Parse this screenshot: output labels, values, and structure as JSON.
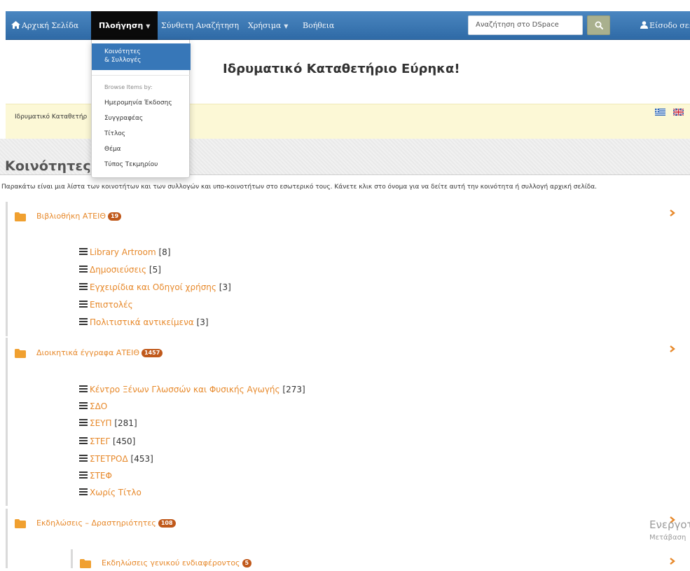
{
  "navbar": {
    "home_label": "Αρχική Σελίδα",
    "browse_label": "Πλοήγηση",
    "advanced_search_label": "Σύνθετη Αναζήτηση",
    "tools_label": "Χρήσιμα",
    "help_label": "Βοήθεια",
    "search_placeholder": "Αναζήτηση στο DSpace",
    "login_label": "Είσοδο σε:",
    "bar_color": "#3c78b4",
    "active_color": "#0a0a0a"
  },
  "dropdown": {
    "active_item_line1": "Κοινότητες",
    "active_item_line2": "& Συλλογές",
    "section_header": "Browse Items by:",
    "items": [
      "Ημερομηνία Έκδοσης",
      "Συγγραφέας",
      "Τίτλος",
      "Θέμα",
      "Τύπος Τεκμηρίου"
    ]
  },
  "header": {
    "title": "Ιδρυματικό Καταθετήριο Εύρηκα!"
  },
  "trail": {
    "text": "Ιδρυματικό Καταθετήρ",
    "flags": [
      "greek-flag-icon",
      "uk-flag-icon"
    ]
  },
  "main": {
    "heading": "Κοινότητες κ",
    "intro": "Παρακάτω είναι μια λίστα των κοινοτήτων και των συλλογών και υπο-κοινοτήτων στο εσωτερικό τους. Κάνετε κλικ στο όνομα για να δείτε αυτή την κοινότητα ή συλλογή αρχική σελίδα.",
    "communities": [
      {
        "name": "Βιβλιοθήκη ΑΤΕΙΘ",
        "count": "19",
        "collections": [
          {
            "name": "Library Artroom",
            "count": "[8]"
          },
          {
            "name": "Δημοσιεύσεις",
            "count": "[5]"
          },
          {
            "name": "Εγχειρίδια και Οδηγοί χρήσης",
            "count": "[3]"
          },
          {
            "name": "Επιστολές",
            "count": ""
          },
          {
            "name": "Πολιτιστικά αντικείμενα",
            "count": "[3]"
          }
        ]
      },
      {
        "name": "Διοικητικά έγγραφα ΑΤΕΙΘ",
        "count": "1457",
        "collections": [
          {
            "name": "Κέντρο Ξένων Γλωσσών και Φυσικής Αγωγής",
            "count": "[273]"
          },
          {
            "name": "ΣΔΟ",
            "count": ""
          },
          {
            "name": "ΣΕΥΠ",
            "count": "[281]"
          },
          {
            "name": "ΣΤΕΓ",
            "count": "[450]"
          },
          {
            "name": "ΣΤΕΤΡΟΔ",
            "count": "[453]"
          },
          {
            "name": "ΣΤΕΦ",
            "count": ""
          },
          {
            "name": "Χωρίς Τίτλο",
            "count": ""
          }
        ]
      },
      {
        "name": "Εκδηλώσεις – Δραστηριότητες",
        "count": "108",
        "subcommunities": [
          {
            "name": "Εκδηλώσεις γενικού ενδιαφέροντος",
            "count": "5"
          }
        ]
      }
    ],
    "link_color": "#e7892b",
    "badge_color": "#c0591b"
  },
  "watermark": {
    "title": "Ενεργοτ",
    "subtitle": "Μετάβαση"
  }
}
